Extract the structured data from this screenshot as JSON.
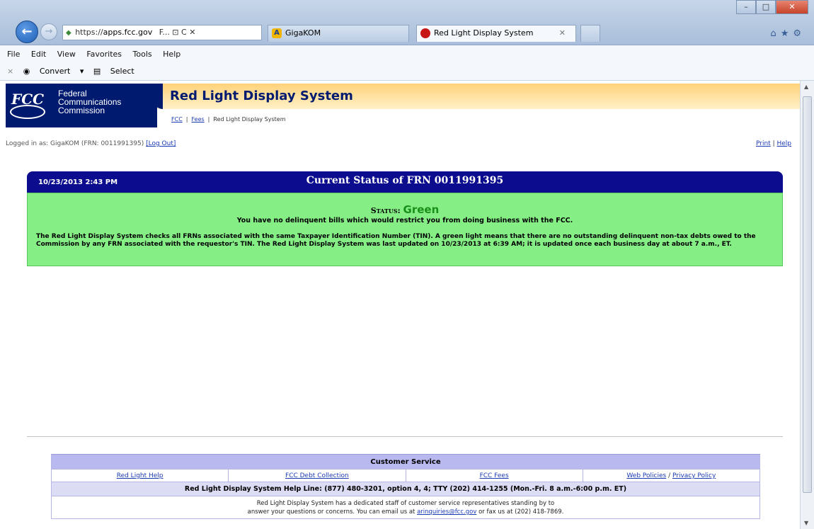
{
  "browser": {
    "address_scheme": "https://",
    "address_host": "apps.fcc.gov",
    "address_rest": "F... ⊡ C ✕",
    "tabs": [
      {
        "label": "GigaKOM"
      },
      {
        "label": "Red Light Display System"
      }
    ]
  },
  "menu": [
    "File",
    "Edit",
    "View",
    "Favorites",
    "Tools",
    "Help"
  ],
  "command_bar": {
    "convert": "Convert",
    "select": "Select"
  },
  "header": {
    "logo_mark": "FCC",
    "logo_line1": "Federal",
    "logo_line2": "Communications",
    "logo_line3": "Commission",
    "app_title": "Red Light Display System",
    "crumb_fcc": "FCC",
    "crumb_fees": "Fees",
    "crumb_current": "Red Light Display System"
  },
  "session": {
    "logged_in_prefix": "Logged in as: GigaKOM (FRN: 0011991395)",
    "logout_label": "[Log Out]",
    "print_label": "Print",
    "help_label": "Help"
  },
  "status": {
    "datetime": "10/23/2013 2:43 PM",
    "title": "Current Status of FRN 0011991395",
    "label": "Status:",
    "value": "Green",
    "message": "You have no delinquent bills which would restrict you from doing business with the FCC.",
    "description": "The Red Light Display System checks all FRNs associated with the same Taxpayer Identification Number (TIN). A green light means that there are no outstanding delinquent non-tax debts owed to the Commission by any FRN associated with the requestor's TIN. The Red Light Display System was last updated on 10/23/2013 at 6:39 AM; it is updated once each business day at about 7 a.m., ET."
  },
  "customer_service": {
    "title": "Customer Service",
    "links": {
      "red_light_help": "Red Light Help",
      "debt_collection": "FCC Debt Collection",
      "fees": "FCC Fees",
      "web_policies": "Web Policies",
      "privacy_policy": "Privacy Policy"
    },
    "helpline": "Red Light Display System Help Line: (877) 480-3201, option 4, 4; TTY (202) 414-1255 (Mon.-Fri. 8 a.m.-6:00 p.m. ET)",
    "info_line1": "Red Light Display System has a dedicated staff of customer service representatives standing by to",
    "info_line2_prefix": "answer your questions or concerns. You can email us at",
    "email": "arinquiries@fcc.gov",
    "info_line2_suffix": "or fax us at (202) 418-7869."
  }
}
